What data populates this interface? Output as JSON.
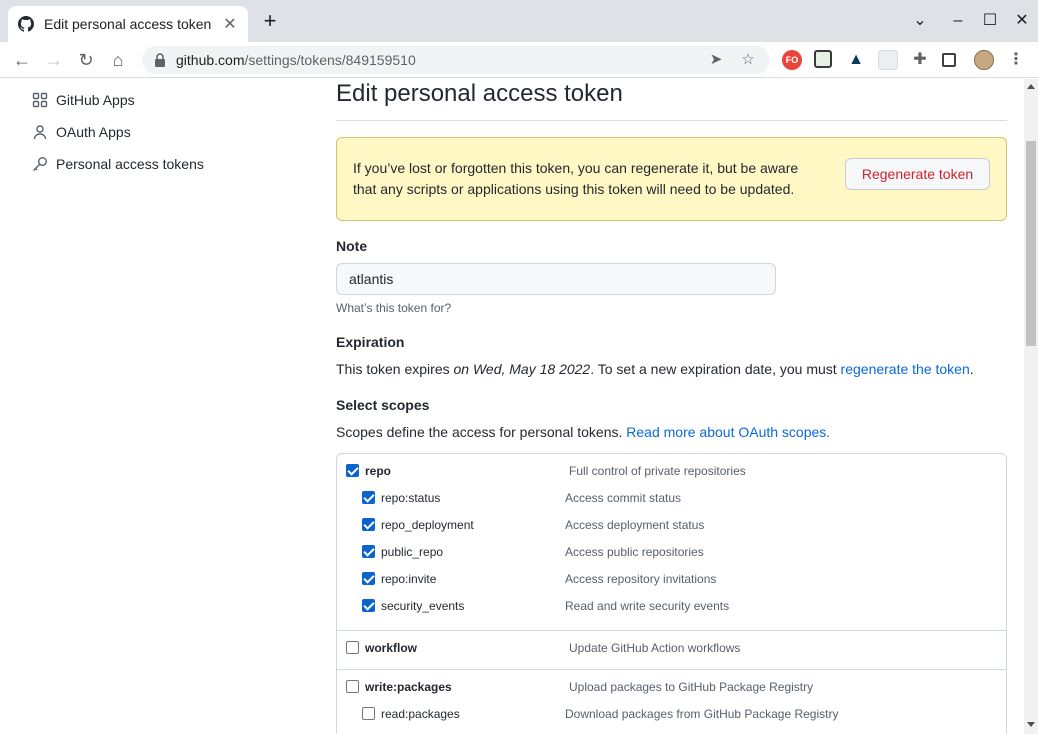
{
  "browser": {
    "tab_title": "Edit personal access token",
    "url_host": "github.com",
    "url_path": "/settings/tokens/849159510",
    "ext_fo_label": "FO"
  },
  "sidebar": {
    "items": [
      {
        "label": "GitHub Apps",
        "icon": "apps-icon"
      },
      {
        "label": "OAuth Apps",
        "icon": "person-icon"
      },
      {
        "label": "Personal access tokens",
        "icon": "key-icon"
      }
    ]
  },
  "main": {
    "title": "Edit personal access token",
    "flash": {
      "message": "If you’ve lost or forgotten this token, you can regenerate it, but be aware that any scripts or applications using this token will need to be updated.",
      "button": "Regenerate token"
    },
    "note": {
      "label": "Note",
      "value": "atlantis",
      "hint": "What’s this token for?"
    },
    "expiration": {
      "label": "Expiration",
      "text_before": "This token expires ",
      "date": "on Wed, May 18 2022",
      "text_after": ". To set a new expiration date, you must ",
      "link": "regenerate the token",
      "end": "."
    },
    "scopes": {
      "label": "Select scopes",
      "text": "Scopes define the access for personal tokens. ",
      "link": "Read more about OAuth scopes.",
      "groups": [
        {
          "name": "repo",
          "desc": "Full control of private repositories",
          "checked": true,
          "children": [
            {
              "name": "repo:status",
              "desc": "Access commit status",
              "checked": true
            },
            {
              "name": "repo_deployment",
              "desc": "Access deployment status",
              "checked": true
            },
            {
              "name": "public_repo",
              "desc": "Access public repositories",
              "checked": true
            },
            {
              "name": "repo:invite",
              "desc": "Access repository invitations",
              "checked": true
            },
            {
              "name": "security_events",
              "desc": "Read and write security events",
              "checked": true
            }
          ]
        },
        {
          "name": "workflow",
          "desc": "Update GitHub Action workflows",
          "checked": false,
          "children": []
        },
        {
          "name": "write:packages",
          "desc": "Upload packages to GitHub Package Registry",
          "checked": false,
          "children": [
            {
              "name": "read:packages",
              "desc": "Download packages from GitHub Package Registry",
              "checked": false
            }
          ]
        }
      ]
    }
  }
}
